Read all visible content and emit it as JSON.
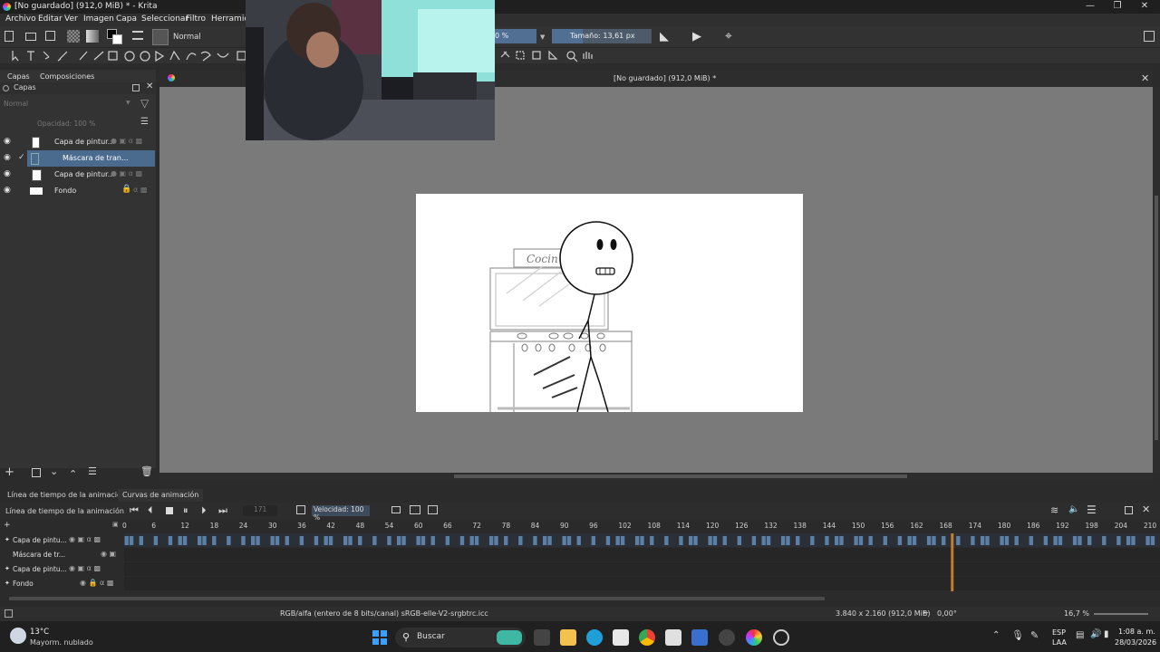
{
  "window": {
    "title": "[No guardado]  (912,0 MiB) * - Krita"
  },
  "menu": {
    "items": [
      "Archivo",
      "Editar",
      "Ver",
      "Imagen",
      "Capa",
      "Seleccionar",
      "Filtro",
      "Herramien"
    ]
  },
  "toolbar": {
    "blend_mode": "Normal",
    "opacity_partial": "0 %",
    "size_label": "Tamaño: 13,61 px"
  },
  "layers_docker": {
    "tabs": [
      "Capas",
      "Composiciones"
    ],
    "title": "Capas",
    "blend_mode": "Normal",
    "opacity": "Opacidad:  100 %",
    "layers": [
      {
        "name": "Capa de pintur...",
        "selected": false
      },
      {
        "name": "Máscara de tran...",
        "selected": true
      },
      {
        "name": "Capa de pintur...",
        "selected": false
      },
      {
        "name": "Fondo",
        "selected": false
      }
    ]
  },
  "document": {
    "tab_title": "[No guardado]  (912,0 MiB) *",
    "sketch_sign": "Cocin"
  },
  "timeline": {
    "tabs": [
      "Línea de tiempo de la animación",
      "Curvas de animación"
    ],
    "title": "Línea de tiempo de la animación",
    "current_frame": "171",
    "speed": "Velocidad: 100 %",
    "ruler_ticks": [
      "0",
      "6",
      "12",
      "18",
      "24",
      "30",
      "36",
      "42",
      "48",
      "54",
      "60",
      "66",
      "72",
      "78",
      "84",
      "90",
      "96",
      "102",
      "108",
      "114",
      "120",
      "126",
      "132",
      "138",
      "144",
      "150",
      "156",
      "162",
      "168",
      "174",
      "180",
      "186",
      "192",
      "198",
      "204",
      "210"
    ],
    "rows": [
      "Capa de pintu...",
      "Máscara de tr...",
      "Capa de pintu...",
      "Fondo"
    ],
    "playhead_frame": 170,
    "frame_range": [
      0,
      213
    ]
  },
  "status": {
    "color_profile": "RGB/alfa (entero de 8 bits/canal)  sRGB-elle-V2-srgbtrc.icc",
    "image_size": "3.840 x 2.160 (912,0 MiB)",
    "rotation": "0,00°",
    "zoom": "16,7 %"
  },
  "taskbar": {
    "temperature": "13°C",
    "weather": "Mayorm. nublado",
    "search": "Buscar",
    "lang1": "ESP",
    "lang2": "LAA",
    "time": "1:08 a. m.",
    "date": "28/03/2026"
  },
  "colors": {
    "accent": "#4a6a8e",
    "keyframe": "#5c7fa6",
    "playhead": "#e08a2c"
  }
}
